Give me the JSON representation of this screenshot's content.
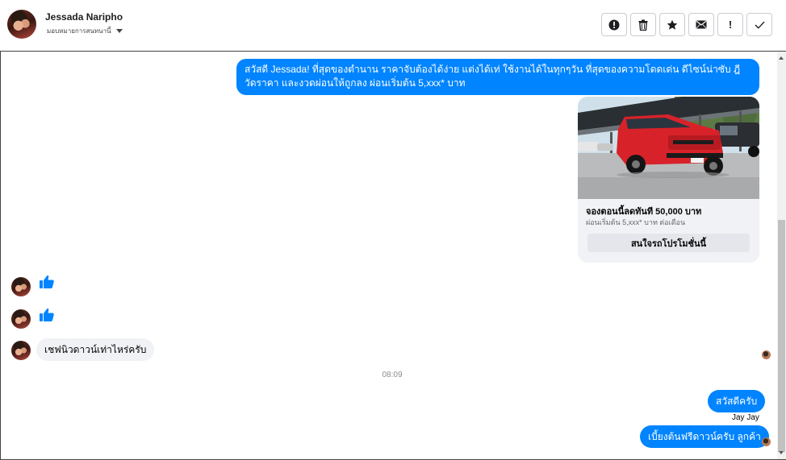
{
  "header": {
    "contact_name": "Jessada Naripho",
    "assign_label": "มอบหมายการสนทนานี้",
    "actions": [
      {
        "name": "spam-button",
        "icon": "alert-circle-icon"
      },
      {
        "name": "delete-button",
        "icon": "trash-icon"
      },
      {
        "name": "star-button",
        "icon": "star-icon"
      },
      {
        "name": "mark-unread-button",
        "icon": "envelope-icon"
      },
      {
        "name": "follow-up-button",
        "icon": "exclamation-icon",
        "glyph": "!"
      },
      {
        "name": "done-button",
        "icon": "check-icon",
        "glyph": "✓"
      }
    ]
  },
  "messages": {
    "promo_text": "สวัสดี Jessada! ที่สุดของตำนาน ราคาจับต้องได้ง่าย แต่งได้เท่ ใช้งานได้ในทุกๆวัน ที่สุดของความโดดเด่น ดีไซน์น่าซับ ฎีวัดราคา และงวดผ่อนให้ถูกลง ผ่อนเริ่มต้น 5,xxx* บาท",
    "card": {
      "title": "จองตอนนี้ลดทันที 50,000 บาท",
      "subtitle": "ผ่อนเริ่มต้น 5,xxx* บาท ต่อเดือน",
      "button": "สนใจรถโปรโมชั่นนี้"
    },
    "incoming_text": "เชฟนิวดาวน์เท่าไหร่ครับ",
    "timestamp": "08:09",
    "reply_1": "สวัสดีครับ",
    "sender_label": "Jay Jay",
    "reply_2": "เบี้ยงต้นฟรีดาวน์ครับ ลูกค้า"
  },
  "colors": {
    "outgoing_bubble": "#0084ff",
    "incoming_bubble": "#f0f2f5",
    "like": "#0084ff"
  }
}
